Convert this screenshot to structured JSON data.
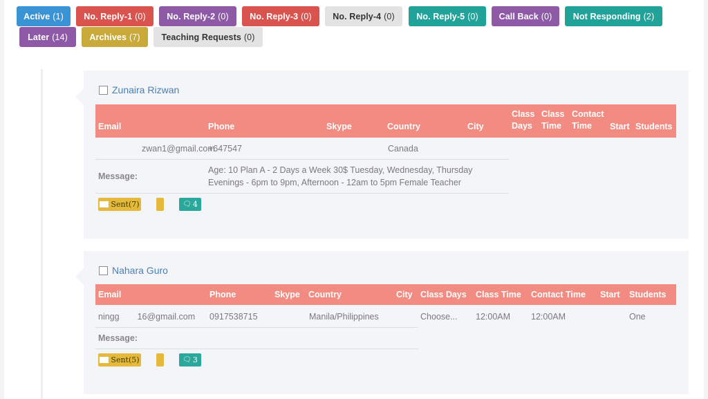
{
  "tabs": [
    {
      "label": "Active",
      "count": "(1)",
      "color": "#3a93d5"
    },
    {
      "label": "No. Reply-1",
      "count": "(0)",
      "color": "#d9534f"
    },
    {
      "label": "No. Reply-2",
      "count": "(0)",
      "color": "#8e5aa8"
    },
    {
      "label": "No. Reply-3",
      "count": "(0)",
      "color": "#d9534f"
    },
    {
      "label": "No. Reply-4",
      "count": "(0)",
      "color": "#e3e3e3"
    },
    {
      "label": "No. Reply-5",
      "count": "(0)",
      "color": "#22a39a"
    },
    {
      "label": "Call Back",
      "count": "(0)",
      "color": "#8e5aa8"
    },
    {
      "label": "Not Responding",
      "count": "(2)",
      "color": "#22a39a"
    },
    {
      "label": "Later",
      "count": "(14)",
      "color": "#8e5aa8"
    },
    {
      "label": "Archives",
      "count": "(7)",
      "color": "#c9a93a"
    },
    {
      "label": "Teaching Requests",
      "count": "(0)",
      "color": "#e3e3e3"
    }
  ],
  "cards": [
    {
      "name": "Zunaira Rizwan",
      "headers": {
        "email": "Email",
        "phone": "Phone",
        "skype": "Skype",
        "country": "Country",
        "city": "City",
        "class_days": "Class Days",
        "class_time": "Class Time",
        "contact_time": "Contact Time",
        "start": "Start",
        "students": "Students"
      },
      "row": {
        "email": "zwan1@gmail.com",
        "phone": "+647547",
        "skype": "",
        "country": "Canada",
        "city": "",
        "class_days": "",
        "class_time": "",
        "contact_time": "",
        "start": "",
        "students": ""
      },
      "message_label": "Message:",
      "message_lines": [
        "Age: 10 Plan A - 2 Days a Week 30$ Tuesday, Wednesday, Thursday",
        "Evenings - 6pm to 9pm, Afternoon - 12am to 5pm Female Teacher"
      ],
      "sent_label": "Sent(7)",
      "comments": "4"
    },
    {
      "name": "Nahara Guro",
      "headers": {
        "email": "Email",
        "phone": "Phone",
        "skype": "Skype",
        "country": "Country",
        "city": "City",
        "class_days": "Class Days",
        "class_time": "Class Time",
        "contact_time": "Contact Time",
        "start": "Start",
        "students": "Students"
      },
      "row": {
        "email": "ningg",
        "email_tail": "16@gmail.com",
        "phone": "09175387",
        "phone_tail": "15",
        "skype": "",
        "country": "Manila/Philippines",
        "city": "",
        "class_days": "Choose...",
        "class_time": "12:00AM",
        "contact_time": "12:00AM",
        "start": "",
        "students": "One"
      },
      "message_label": "Message:",
      "message_lines": [],
      "sent_label": "Sent(5)",
      "comments": "3"
    }
  ]
}
